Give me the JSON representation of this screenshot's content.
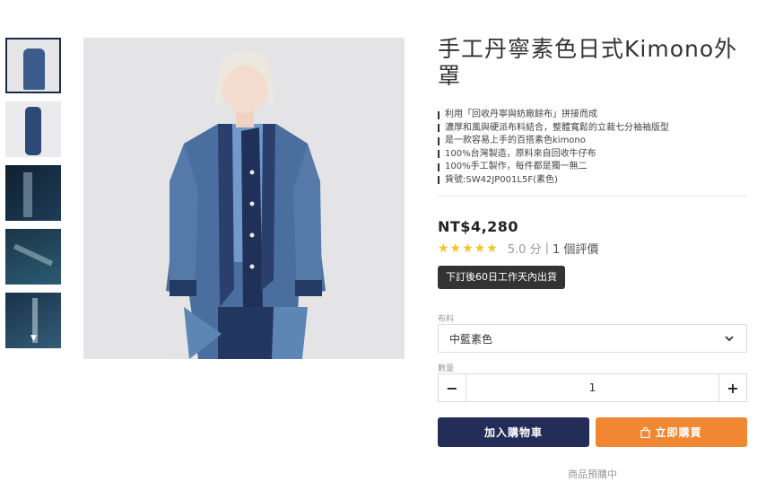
{
  "product": {
    "title": "手工丹寧素色日式Kimono外罩",
    "features": [
      "利用「回收丹寧與紡廠餘布」拼接而成",
      "濃厚和風與硬派布料結合，整體寬鬆的立裁七分袖袖版型",
      "是一款容易上手的百搭素色kimono",
      "100%台灣製造，原料來自回收牛仔布",
      "100%手工製作，每件都是獨一無二",
      "貨號:SW42JP001L5F(素色)"
    ],
    "price": "NT$4,280",
    "rating": {
      "stars": 5,
      "stars_text": "★★★★★",
      "score_text": "5.0 分",
      "separator": "|",
      "reviews_text": "1 個評價"
    },
    "shipping_badge": "下訂後60日工作天內出貨"
  },
  "options": {
    "fabric_label": "布料",
    "fabric_selected": "中藍素色",
    "quantity_label": "數量",
    "quantity_value": "1",
    "minus": "−",
    "plus": "+"
  },
  "actions": {
    "add_to_cart": "加入購物車",
    "buy_now": "立即購買",
    "preorder_note": "商品預購中"
  },
  "gallery": {
    "thumbnail_count": 5,
    "active_index": 0,
    "more_arrow": "▼"
  },
  "colors": {
    "cart_button": "#242d57",
    "buy_button": "#f08732",
    "stars": "#f7c323",
    "badge": "#333333"
  }
}
